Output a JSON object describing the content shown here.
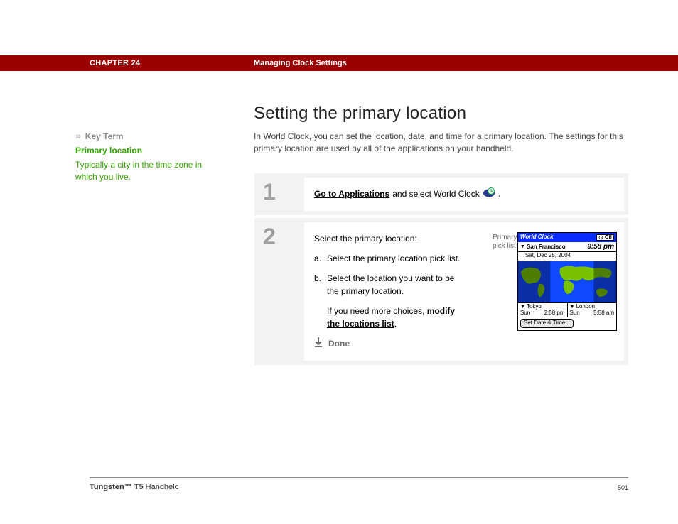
{
  "header": {
    "chapter_label": "CHAPTER 24",
    "chapter_title": "Managing Clock Settings"
  },
  "sidebar": {
    "key_term_label": "Key Term",
    "key_term_name": "Primary location",
    "key_term_def": "Typically a city in the time zone in which you live."
  },
  "main": {
    "title": "Setting the primary location",
    "intro": "In World Clock, you can set the location, date, and time for a primary location. The settings for this primary location are used by all of the applications on your handheld.",
    "step1": {
      "number": "1",
      "link_text": "Go to Applications",
      "rest_text": " and select World Clock ",
      "period": "."
    },
    "step2": {
      "number": "2",
      "lead": "Select the primary location:",
      "a_mark": "a.",
      "a_text": "Select the primary location pick list.",
      "b_mark": "b.",
      "b_text": "Select the location you want to be the primary location.",
      "note_pre": "If you need more choices, ",
      "note_link": "modify the locations list",
      "note_post": ".",
      "done_label": "Done"
    },
    "annotation": "Primary location pick list"
  },
  "screenshot": {
    "app_title": "World Clock",
    "off_label": "Off",
    "primary_city": "San Francisco",
    "primary_time": "9:58 pm",
    "primary_date": "Sat, Dec 25, 2004",
    "city2": "Tokyo",
    "city2_day": "Sun",
    "city2_time": "2:58 pm",
    "city3": "London",
    "city3_day": "Sun",
    "city3_time": "5:58 am",
    "button": "Set Date & Time..."
  },
  "footer": {
    "product_bold": "Tungsten™ T5",
    "product_rest": " Handheld",
    "page": "501"
  }
}
